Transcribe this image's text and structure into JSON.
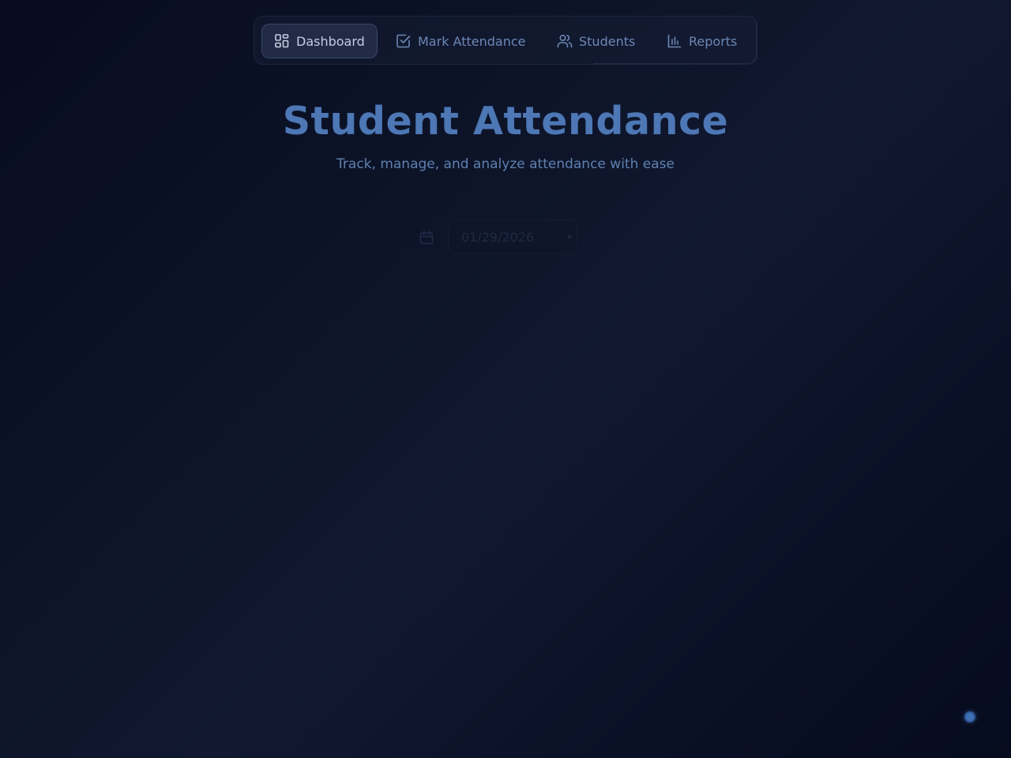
{
  "nav": {
    "items": [
      {
        "label": "Dashboard",
        "icon": "dashboard-grid-icon",
        "active": true
      },
      {
        "label": "Mark Attendance",
        "icon": "checkbox-icon",
        "active": false
      },
      {
        "label": "Students",
        "icon": "users-icon",
        "active": false
      },
      {
        "label": "Reports",
        "icon": "bar-chart-icon",
        "active": false
      }
    ]
  },
  "header": {
    "title": "Student Attendance",
    "subtitle": "Track, manage, and analyze attendance with ease"
  },
  "date_picker": {
    "value": "01/29/2026",
    "icon": "calendar-icon"
  },
  "colors": {
    "accent": "#4d77b5",
    "background": "#0d1428",
    "nav_text": "#6c87b4",
    "nav_active_text": "#c2cde0"
  }
}
